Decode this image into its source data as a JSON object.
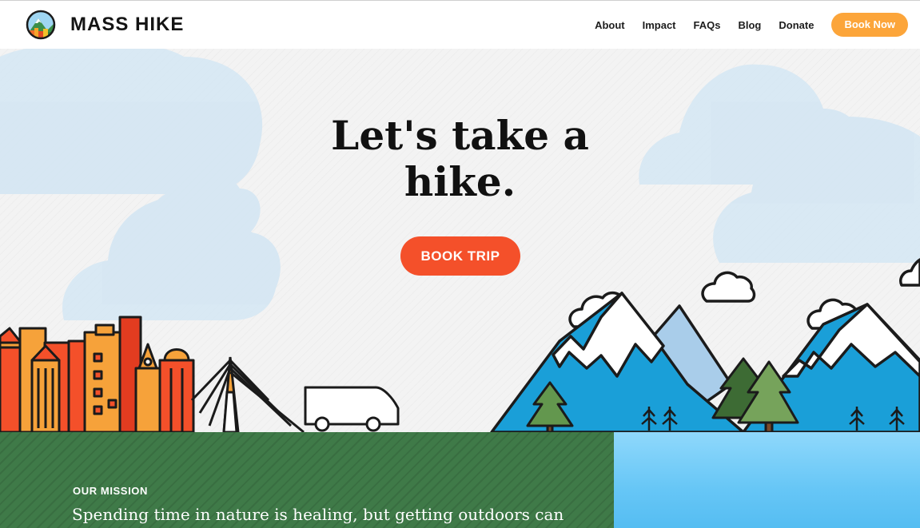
{
  "brand": {
    "name": "MASS HIKE",
    "logo_icon": "mountain-badge-icon"
  },
  "nav": {
    "items": [
      "About",
      "Impact",
      "FAQs",
      "Blog",
      "Donate"
    ],
    "cta_label": "Book Now"
  },
  "hero": {
    "headline_line1": "Let's take a",
    "headline_line2": "hike.",
    "cta_label": "BOOK TRIP",
    "illustration": [
      "city-skyline-icon",
      "bridge-icon",
      "van-icon",
      "mountains-icon",
      "pine-tree-icon",
      "cloud-icon"
    ]
  },
  "mission": {
    "label": "OUR MISSION",
    "text": "Spending time in nature is healing, but getting outdoors can"
  },
  "colors": {
    "accent_orange": "#fca53a",
    "cta_red": "#f4502a",
    "mission_green": "#3f7a48",
    "mountain_blue": "#1a9fd8",
    "sky_blue": "#66c6f6"
  }
}
